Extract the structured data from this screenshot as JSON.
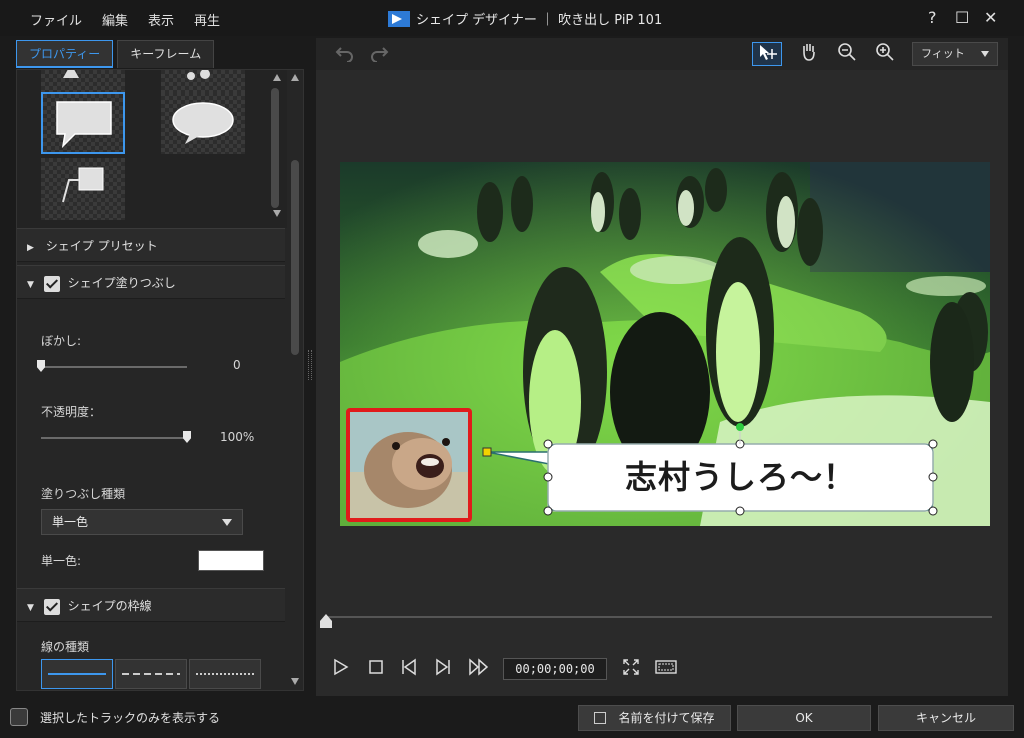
{
  "menu": [
    "ファイル",
    "編集",
    "表示",
    "再生"
  ],
  "window": {
    "title": "シェイプ デザイナー ｜ 吹き出し PiP 101",
    "help": "?",
    "maximize": "☐",
    "close": "✕"
  },
  "tabs": [
    {
      "label": "プロパティー",
      "active": true
    },
    {
      "label": "キーフレーム",
      "active": false
    }
  ],
  "sections": {
    "shape_preset": "シェイプ プリセット",
    "shape_fill": "シェイプ塗りつぶし",
    "shape_border": "シェイプの枠線"
  },
  "fill": {
    "blur_label": "ぼかし:",
    "blur_value": "0",
    "blur_level": 0,
    "opacity_label": "不透明度：",
    "opacity_value": "100%",
    "opacity_level": 100,
    "fill_type_label": "塗りつぶし種類",
    "fill_type_value": "単一色",
    "solid_color_label": "単一色:",
    "solid_color": "#ffffff"
  },
  "border": {
    "line_type_label": "線の種類"
  },
  "toolbar": {
    "undo_icon": "undo-icon",
    "redo_icon": "redo-icon",
    "fit_label": "フィット"
  },
  "preview": {
    "caption": "志村うしろ～！"
  },
  "playback": {
    "timecode": "00;00;00;00"
  },
  "bottom": {
    "checkbox_label": "選択したトラックのみを表示する",
    "save_as": "名前を付けて保存",
    "ok": "OK",
    "cancel": "キャンセル"
  },
  "colors": {
    "accent": "#3d97ee",
    "pip_border": "#e01b1b",
    "handle_green": "#2ecc40",
    "anchor_yellow": "#f2d200"
  }
}
